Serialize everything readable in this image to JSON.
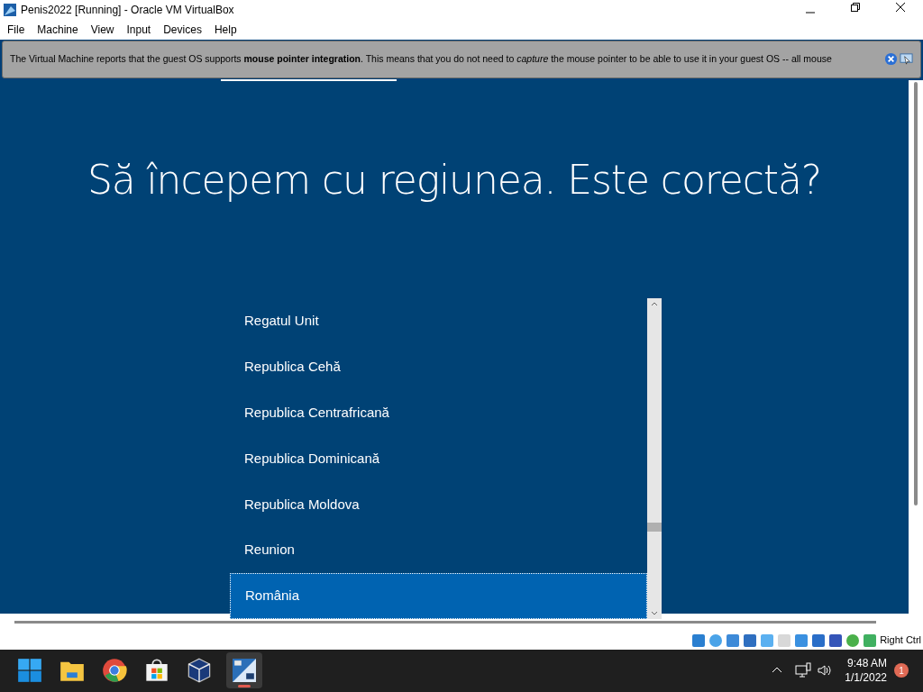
{
  "window": {
    "title": "Penis2022 [Running] - Oracle VM VirtualBox"
  },
  "menu": [
    "File",
    "Machine",
    "View",
    "Input",
    "Devices",
    "Help"
  ],
  "notice": {
    "message": "The Virtual Machine reports that the guest OS supports **mouse pointer integration**. This means that you do not need to *capture* the mouse pointer to be able to use it in your guest OS -- all mouse"
  },
  "guest": {
    "heading": "Să începem cu regiunea. Este corectă?",
    "regions": [
      {
        "label": "Regatul Unit",
        "selected": false
      },
      {
        "label": "Republica Cehă",
        "selected": false
      },
      {
        "label": "Republica Centrafricană",
        "selected": false
      },
      {
        "label": "Republica Dominicană",
        "selected": false
      },
      {
        "label": "Republica Moldova",
        "selected": false
      },
      {
        "label": "Reunion",
        "selected": false
      },
      {
        "label": "România",
        "selected": true
      }
    ]
  },
  "status_bar": {
    "host_key": "Right Ctrl"
  },
  "taskbar": {
    "time": "9:48 AM",
    "date": "1/1/2022",
    "notifications": "1"
  }
}
